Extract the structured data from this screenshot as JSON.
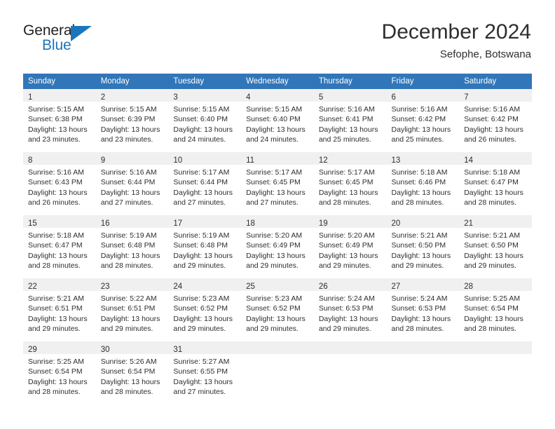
{
  "brand": {
    "name_top": "General",
    "name_bottom": "Blue",
    "flag_icon": "triangle-flag-icon",
    "accent_color": "#1b75bb"
  },
  "header": {
    "title": "December 2024",
    "subtitle": "Sefophe, Botswana"
  },
  "calendar": {
    "header_bg": "#3176b9",
    "daynum_band_bg": "#f0f0f0",
    "weekday_headers": [
      "Sunday",
      "Monday",
      "Tuesday",
      "Wednesday",
      "Thursday",
      "Friday",
      "Saturday"
    ],
    "weeks": [
      [
        {
          "day": "1",
          "sunrise": "Sunrise: 5:15 AM",
          "sunset": "Sunset: 6:38 PM",
          "daylight_line1": "Daylight: 13 hours",
          "daylight_line2": "and 23 minutes."
        },
        {
          "day": "2",
          "sunrise": "Sunrise: 5:15 AM",
          "sunset": "Sunset: 6:39 PM",
          "daylight_line1": "Daylight: 13 hours",
          "daylight_line2": "and 23 minutes."
        },
        {
          "day": "3",
          "sunrise": "Sunrise: 5:15 AM",
          "sunset": "Sunset: 6:40 PM",
          "daylight_line1": "Daylight: 13 hours",
          "daylight_line2": "and 24 minutes."
        },
        {
          "day": "4",
          "sunrise": "Sunrise: 5:15 AM",
          "sunset": "Sunset: 6:40 PM",
          "daylight_line1": "Daylight: 13 hours",
          "daylight_line2": "and 24 minutes."
        },
        {
          "day": "5",
          "sunrise": "Sunrise: 5:16 AM",
          "sunset": "Sunset: 6:41 PM",
          "daylight_line1": "Daylight: 13 hours",
          "daylight_line2": "and 25 minutes."
        },
        {
          "day": "6",
          "sunrise": "Sunrise: 5:16 AM",
          "sunset": "Sunset: 6:42 PM",
          "daylight_line1": "Daylight: 13 hours",
          "daylight_line2": "and 25 minutes."
        },
        {
          "day": "7",
          "sunrise": "Sunrise: 5:16 AM",
          "sunset": "Sunset: 6:42 PM",
          "daylight_line1": "Daylight: 13 hours",
          "daylight_line2": "and 26 minutes."
        }
      ],
      [
        {
          "day": "8",
          "sunrise": "Sunrise: 5:16 AM",
          "sunset": "Sunset: 6:43 PM",
          "daylight_line1": "Daylight: 13 hours",
          "daylight_line2": "and 26 minutes."
        },
        {
          "day": "9",
          "sunrise": "Sunrise: 5:16 AM",
          "sunset": "Sunset: 6:44 PM",
          "daylight_line1": "Daylight: 13 hours",
          "daylight_line2": "and 27 minutes."
        },
        {
          "day": "10",
          "sunrise": "Sunrise: 5:17 AM",
          "sunset": "Sunset: 6:44 PM",
          "daylight_line1": "Daylight: 13 hours",
          "daylight_line2": "and 27 minutes."
        },
        {
          "day": "11",
          "sunrise": "Sunrise: 5:17 AM",
          "sunset": "Sunset: 6:45 PM",
          "daylight_line1": "Daylight: 13 hours",
          "daylight_line2": "and 27 minutes."
        },
        {
          "day": "12",
          "sunrise": "Sunrise: 5:17 AM",
          "sunset": "Sunset: 6:45 PM",
          "daylight_line1": "Daylight: 13 hours",
          "daylight_line2": "and 28 minutes."
        },
        {
          "day": "13",
          "sunrise": "Sunrise: 5:18 AM",
          "sunset": "Sunset: 6:46 PM",
          "daylight_line1": "Daylight: 13 hours",
          "daylight_line2": "and 28 minutes."
        },
        {
          "day": "14",
          "sunrise": "Sunrise: 5:18 AM",
          "sunset": "Sunset: 6:47 PM",
          "daylight_line1": "Daylight: 13 hours",
          "daylight_line2": "and 28 minutes."
        }
      ],
      [
        {
          "day": "15",
          "sunrise": "Sunrise: 5:18 AM",
          "sunset": "Sunset: 6:47 PM",
          "daylight_line1": "Daylight: 13 hours",
          "daylight_line2": "and 28 minutes."
        },
        {
          "day": "16",
          "sunrise": "Sunrise: 5:19 AM",
          "sunset": "Sunset: 6:48 PM",
          "daylight_line1": "Daylight: 13 hours",
          "daylight_line2": "and 28 minutes."
        },
        {
          "day": "17",
          "sunrise": "Sunrise: 5:19 AM",
          "sunset": "Sunset: 6:48 PM",
          "daylight_line1": "Daylight: 13 hours",
          "daylight_line2": "and 29 minutes."
        },
        {
          "day": "18",
          "sunrise": "Sunrise: 5:20 AM",
          "sunset": "Sunset: 6:49 PM",
          "daylight_line1": "Daylight: 13 hours",
          "daylight_line2": "and 29 minutes."
        },
        {
          "day": "19",
          "sunrise": "Sunrise: 5:20 AM",
          "sunset": "Sunset: 6:49 PM",
          "daylight_line1": "Daylight: 13 hours",
          "daylight_line2": "and 29 minutes."
        },
        {
          "day": "20",
          "sunrise": "Sunrise: 5:21 AM",
          "sunset": "Sunset: 6:50 PM",
          "daylight_line1": "Daylight: 13 hours",
          "daylight_line2": "and 29 minutes."
        },
        {
          "day": "21",
          "sunrise": "Sunrise: 5:21 AM",
          "sunset": "Sunset: 6:50 PM",
          "daylight_line1": "Daylight: 13 hours",
          "daylight_line2": "and 29 minutes."
        }
      ],
      [
        {
          "day": "22",
          "sunrise": "Sunrise: 5:21 AM",
          "sunset": "Sunset: 6:51 PM",
          "daylight_line1": "Daylight: 13 hours",
          "daylight_line2": "and 29 minutes."
        },
        {
          "day": "23",
          "sunrise": "Sunrise: 5:22 AM",
          "sunset": "Sunset: 6:51 PM",
          "daylight_line1": "Daylight: 13 hours",
          "daylight_line2": "and 29 minutes."
        },
        {
          "day": "24",
          "sunrise": "Sunrise: 5:23 AM",
          "sunset": "Sunset: 6:52 PM",
          "daylight_line1": "Daylight: 13 hours",
          "daylight_line2": "and 29 minutes."
        },
        {
          "day": "25",
          "sunrise": "Sunrise: 5:23 AM",
          "sunset": "Sunset: 6:52 PM",
          "daylight_line1": "Daylight: 13 hours",
          "daylight_line2": "and 29 minutes."
        },
        {
          "day": "26",
          "sunrise": "Sunrise: 5:24 AM",
          "sunset": "Sunset: 6:53 PM",
          "daylight_line1": "Daylight: 13 hours",
          "daylight_line2": "and 29 minutes."
        },
        {
          "day": "27",
          "sunrise": "Sunrise: 5:24 AM",
          "sunset": "Sunset: 6:53 PM",
          "daylight_line1": "Daylight: 13 hours",
          "daylight_line2": "and 28 minutes."
        },
        {
          "day": "28",
          "sunrise": "Sunrise: 5:25 AM",
          "sunset": "Sunset: 6:54 PM",
          "daylight_line1": "Daylight: 13 hours",
          "daylight_line2": "and 28 minutes."
        }
      ],
      [
        {
          "day": "29",
          "sunrise": "Sunrise: 5:25 AM",
          "sunset": "Sunset: 6:54 PM",
          "daylight_line1": "Daylight: 13 hours",
          "daylight_line2": "and 28 minutes."
        },
        {
          "day": "30",
          "sunrise": "Sunrise: 5:26 AM",
          "sunset": "Sunset: 6:54 PM",
          "daylight_line1": "Daylight: 13 hours",
          "daylight_line2": "and 28 minutes."
        },
        {
          "day": "31",
          "sunrise": "Sunrise: 5:27 AM",
          "sunset": "Sunset: 6:55 PM",
          "daylight_line1": "Daylight: 13 hours",
          "daylight_line2": "and 27 minutes."
        },
        {
          "day": "",
          "sunrise": "",
          "sunset": "",
          "daylight_line1": "",
          "daylight_line2": ""
        },
        {
          "day": "",
          "sunrise": "",
          "sunset": "",
          "daylight_line1": "",
          "daylight_line2": ""
        },
        {
          "day": "",
          "sunrise": "",
          "sunset": "",
          "daylight_line1": "",
          "daylight_line2": ""
        },
        {
          "day": "",
          "sunrise": "",
          "sunset": "",
          "daylight_line1": "",
          "daylight_line2": ""
        }
      ]
    ]
  }
}
